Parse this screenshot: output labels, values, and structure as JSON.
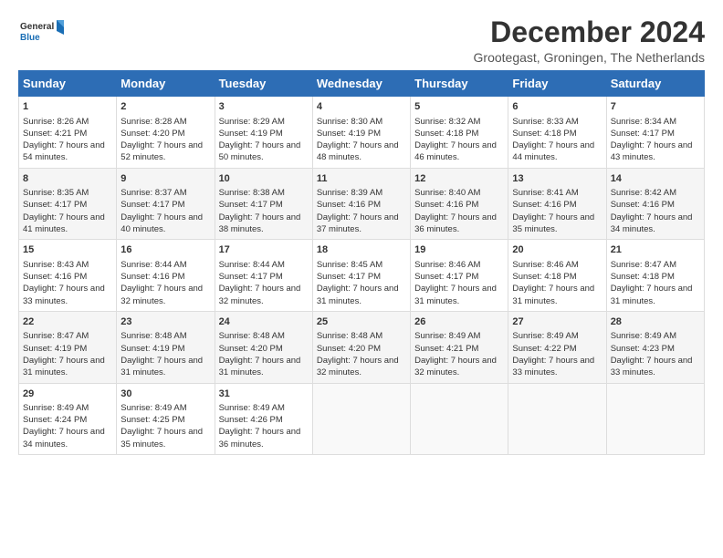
{
  "logo": {
    "line1": "General",
    "line2": "Blue"
  },
  "title": "December 2024",
  "subtitle": "Grootegast, Groningen, The Netherlands",
  "days_of_week": [
    "Sunday",
    "Monday",
    "Tuesday",
    "Wednesday",
    "Thursday",
    "Friday",
    "Saturday"
  ],
  "weeks": [
    [
      {
        "day": "1",
        "sunrise": "Sunrise: 8:26 AM",
        "sunset": "Sunset: 4:21 PM",
        "daylight": "Daylight: 7 hours and 54 minutes."
      },
      {
        "day": "2",
        "sunrise": "Sunrise: 8:28 AM",
        "sunset": "Sunset: 4:20 PM",
        "daylight": "Daylight: 7 hours and 52 minutes."
      },
      {
        "day": "3",
        "sunrise": "Sunrise: 8:29 AM",
        "sunset": "Sunset: 4:19 PM",
        "daylight": "Daylight: 7 hours and 50 minutes."
      },
      {
        "day": "4",
        "sunrise": "Sunrise: 8:30 AM",
        "sunset": "Sunset: 4:19 PM",
        "daylight": "Daylight: 7 hours and 48 minutes."
      },
      {
        "day": "5",
        "sunrise": "Sunrise: 8:32 AM",
        "sunset": "Sunset: 4:18 PM",
        "daylight": "Daylight: 7 hours and 46 minutes."
      },
      {
        "day": "6",
        "sunrise": "Sunrise: 8:33 AM",
        "sunset": "Sunset: 4:18 PM",
        "daylight": "Daylight: 7 hours and 44 minutes."
      },
      {
        "day": "7",
        "sunrise": "Sunrise: 8:34 AM",
        "sunset": "Sunset: 4:17 PM",
        "daylight": "Daylight: 7 hours and 43 minutes."
      }
    ],
    [
      {
        "day": "8",
        "sunrise": "Sunrise: 8:35 AM",
        "sunset": "Sunset: 4:17 PM",
        "daylight": "Daylight: 7 hours and 41 minutes."
      },
      {
        "day": "9",
        "sunrise": "Sunrise: 8:37 AM",
        "sunset": "Sunset: 4:17 PM",
        "daylight": "Daylight: 7 hours and 40 minutes."
      },
      {
        "day": "10",
        "sunrise": "Sunrise: 8:38 AM",
        "sunset": "Sunset: 4:17 PM",
        "daylight": "Daylight: 7 hours and 38 minutes."
      },
      {
        "day": "11",
        "sunrise": "Sunrise: 8:39 AM",
        "sunset": "Sunset: 4:16 PM",
        "daylight": "Daylight: 7 hours and 37 minutes."
      },
      {
        "day": "12",
        "sunrise": "Sunrise: 8:40 AM",
        "sunset": "Sunset: 4:16 PM",
        "daylight": "Daylight: 7 hours and 36 minutes."
      },
      {
        "day": "13",
        "sunrise": "Sunrise: 8:41 AM",
        "sunset": "Sunset: 4:16 PM",
        "daylight": "Daylight: 7 hours and 35 minutes."
      },
      {
        "day": "14",
        "sunrise": "Sunrise: 8:42 AM",
        "sunset": "Sunset: 4:16 PM",
        "daylight": "Daylight: 7 hours and 34 minutes."
      }
    ],
    [
      {
        "day": "15",
        "sunrise": "Sunrise: 8:43 AM",
        "sunset": "Sunset: 4:16 PM",
        "daylight": "Daylight: 7 hours and 33 minutes."
      },
      {
        "day": "16",
        "sunrise": "Sunrise: 8:44 AM",
        "sunset": "Sunset: 4:16 PM",
        "daylight": "Daylight: 7 hours and 32 minutes."
      },
      {
        "day": "17",
        "sunrise": "Sunrise: 8:44 AM",
        "sunset": "Sunset: 4:17 PM",
        "daylight": "Daylight: 7 hours and 32 minutes."
      },
      {
        "day": "18",
        "sunrise": "Sunrise: 8:45 AM",
        "sunset": "Sunset: 4:17 PM",
        "daylight": "Daylight: 7 hours and 31 minutes."
      },
      {
        "day": "19",
        "sunrise": "Sunrise: 8:46 AM",
        "sunset": "Sunset: 4:17 PM",
        "daylight": "Daylight: 7 hours and 31 minutes."
      },
      {
        "day": "20",
        "sunrise": "Sunrise: 8:46 AM",
        "sunset": "Sunset: 4:18 PM",
        "daylight": "Daylight: 7 hours and 31 minutes."
      },
      {
        "day": "21",
        "sunrise": "Sunrise: 8:47 AM",
        "sunset": "Sunset: 4:18 PM",
        "daylight": "Daylight: 7 hours and 31 minutes."
      }
    ],
    [
      {
        "day": "22",
        "sunrise": "Sunrise: 8:47 AM",
        "sunset": "Sunset: 4:19 PM",
        "daylight": "Daylight: 7 hours and 31 minutes."
      },
      {
        "day": "23",
        "sunrise": "Sunrise: 8:48 AM",
        "sunset": "Sunset: 4:19 PM",
        "daylight": "Daylight: 7 hours and 31 minutes."
      },
      {
        "day": "24",
        "sunrise": "Sunrise: 8:48 AM",
        "sunset": "Sunset: 4:20 PM",
        "daylight": "Daylight: 7 hours and 31 minutes."
      },
      {
        "day": "25",
        "sunrise": "Sunrise: 8:48 AM",
        "sunset": "Sunset: 4:20 PM",
        "daylight": "Daylight: 7 hours and 32 minutes."
      },
      {
        "day": "26",
        "sunrise": "Sunrise: 8:49 AM",
        "sunset": "Sunset: 4:21 PM",
        "daylight": "Daylight: 7 hours and 32 minutes."
      },
      {
        "day": "27",
        "sunrise": "Sunrise: 8:49 AM",
        "sunset": "Sunset: 4:22 PM",
        "daylight": "Daylight: 7 hours and 33 minutes."
      },
      {
        "day": "28",
        "sunrise": "Sunrise: 8:49 AM",
        "sunset": "Sunset: 4:23 PM",
        "daylight": "Daylight: 7 hours and 33 minutes."
      }
    ],
    [
      {
        "day": "29",
        "sunrise": "Sunrise: 8:49 AM",
        "sunset": "Sunset: 4:24 PM",
        "daylight": "Daylight: 7 hours and 34 minutes."
      },
      {
        "day": "30",
        "sunrise": "Sunrise: 8:49 AM",
        "sunset": "Sunset: 4:25 PM",
        "daylight": "Daylight: 7 hours and 35 minutes."
      },
      {
        "day": "31",
        "sunrise": "Sunrise: 8:49 AM",
        "sunset": "Sunset: 4:26 PM",
        "daylight": "Daylight: 7 hours and 36 minutes."
      },
      null,
      null,
      null,
      null
    ]
  ]
}
